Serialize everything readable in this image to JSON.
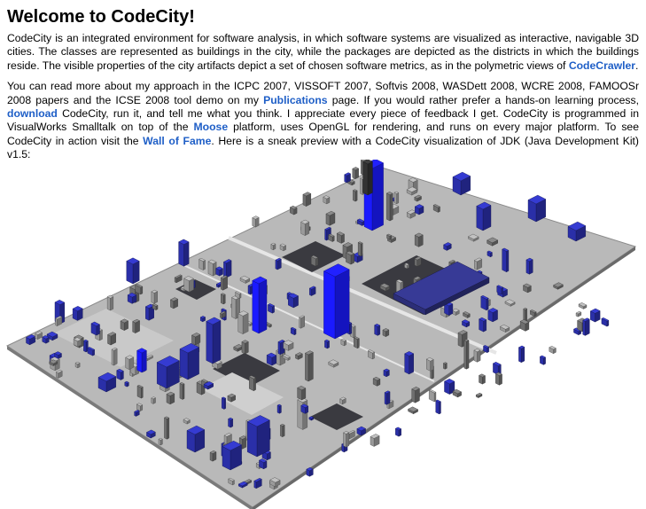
{
  "page": {
    "title": "Welcome to CodeCity!"
  },
  "intro": {
    "text_1": "CodeCity is an integrated environment for software analysis, in which software systems are visualized as interactive, navigable 3D cities. The classes are represented as buildings in the city, while the packages are depicted as the districts in which the buildings reside. The visible properties of the city artifacts depict a set of chosen software metrics, as in the polymetric views of ",
    "link_codecrawler": "CodeCrawler",
    "text_2": "."
  },
  "about": {
    "text_1": "You can read more about my approach in the ICPC 2007, VISSOFT 2007, Softvis 2008, WASDett 2008, WCRE 2008, FAMOOSr 2008 papers and the ICSE 2008 tool demo on my ",
    "link_publications": "Publications",
    "text_2": " page. If you would rather prefer a hands-on learning process, ",
    "link_download": "download",
    "text_3": " CodeCity, run it, and tell me what you think. I appreciate every piece of feedback I get. CodeCity is programmed in VisualWorks Smalltalk on top of the ",
    "link_moose": "Moose",
    "text_4": " platform, uses OpenGL for rendering, and runs on every major platform. To see CodeCity in action visit the ",
    "link_wall": "Wall of Fame",
    "text_5": ". Here is a sneak preview with a CodeCity visualization of JDK (Java Development Kit) v1.5:"
  },
  "colors": {
    "link": "#1f5fc7",
    "building_blue": "#2a2fa8",
    "building_bright": "#1a1aff",
    "district_gray": "#bdbdbd",
    "district_dark": "#3c3c44"
  }
}
